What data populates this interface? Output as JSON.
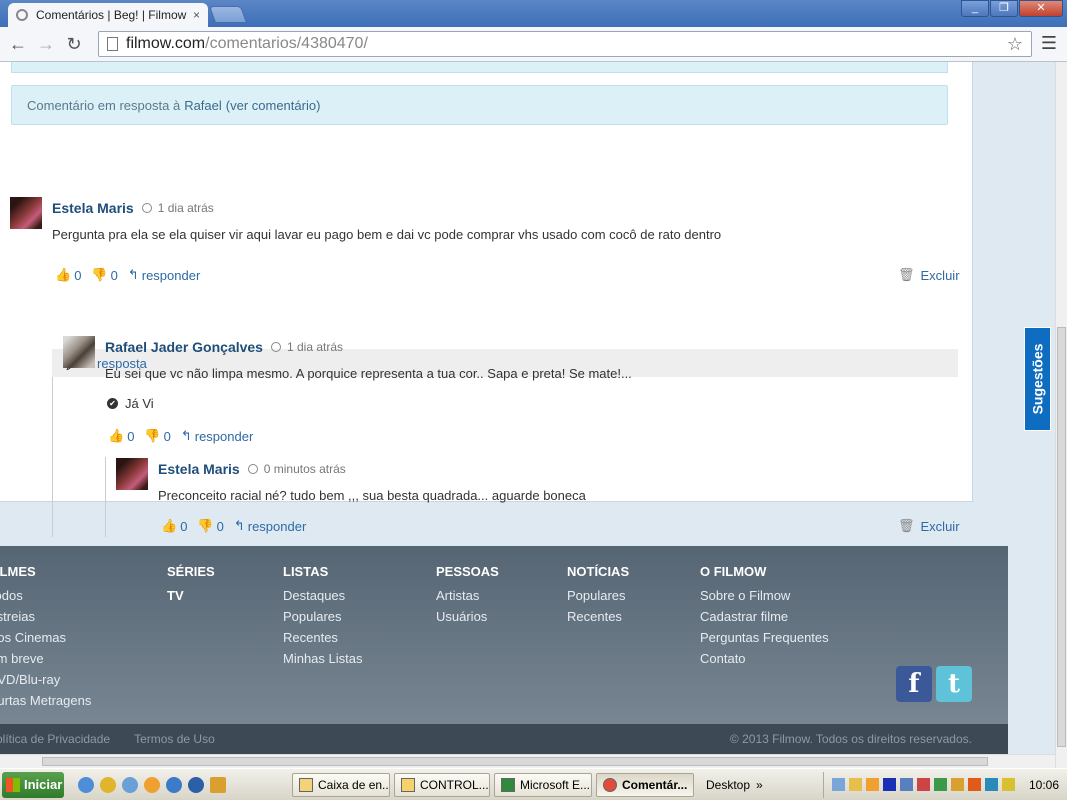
{
  "browser": {
    "tab_title": "Comentários | Beg! | Filmow",
    "tab_close": "×",
    "url_host": "filmow.com",
    "url_path": "/comentarios/4380470/",
    "window_controls": [
      "_",
      "❐",
      "✕"
    ]
  },
  "reply_note": {
    "prefix": "Comentário em resposta à",
    "name": "Rafael",
    "link": "(ver comentário)"
  },
  "comments": [
    {
      "author": "Estela Maris",
      "time": "1 dia atrás",
      "text": "Pergunta pra ela se ela quiser vir aqui lavar eu pago bem e dai vc pode comprar vhs usado com cocô de rato dentro",
      "likes": "0",
      "dislikes": "0",
      "reply_label": "responder",
      "delete_label": "Excluir"
    },
    {
      "author": "Rafael Jader Gonçalves",
      "time": "1 dia atrás",
      "text": "Eu sei que vc não limpa mesmo. A porquice representa a tua cor.. Sapa e preta! Se mate!...",
      "seen_label": "Já Vi",
      "likes": "0",
      "dislikes": "0",
      "reply_label": "responder"
    },
    {
      "author": "Estela Maris",
      "time": "0 minutos atrás",
      "text": "Preconceito racial né? tudo bem ,,, sua besta quadrada... aguarde boneca",
      "likes": "0",
      "dislikes": "0",
      "reply_label": "responder",
      "delete_label": "Excluir"
    }
  ],
  "replies_bar": "1 resposta",
  "sidebar_tab": "Sugestões",
  "footer": {
    "columns": [
      {
        "head": "FILMES",
        "links": [
          "Todos",
          "Estreias",
          "Nos Cinemas",
          "Em breve",
          "DVD/Blu-ray",
          "Curtas Metragens"
        ]
      },
      {
        "head": "SÉRIES",
        "links": [
          "TV"
        ]
      },
      {
        "head": "LISTAS",
        "links": [
          "Destaques",
          "Populares",
          "Recentes",
          "Minhas Listas"
        ]
      },
      {
        "head": "PESSOAS",
        "links": [
          "Artistas",
          "Usuários"
        ]
      },
      {
        "head": "NOTÍCIAS",
        "links": [
          "Populares",
          "Recentes"
        ]
      },
      {
        "head": "O FILMOW",
        "links": [
          "Sobre o Filmow",
          "Cadastrar filme",
          "Perguntas Frequentes",
          "Contato"
        ]
      }
    ],
    "bottom_links": [
      "Política de Privacidade",
      "Termos de Uso"
    ],
    "copyright": "© 2013 Filmow. Todos os direitos reservados.",
    "social": [
      "f",
      "t"
    ]
  },
  "taskbar": {
    "start": "Iniciar",
    "tasks": [
      "Caixa de en...",
      "CONTROL...",
      "Microsoft E...",
      "Comentár..."
    ],
    "desktop": "Desktop",
    "chevron": "»",
    "clock": "10:06"
  }
}
